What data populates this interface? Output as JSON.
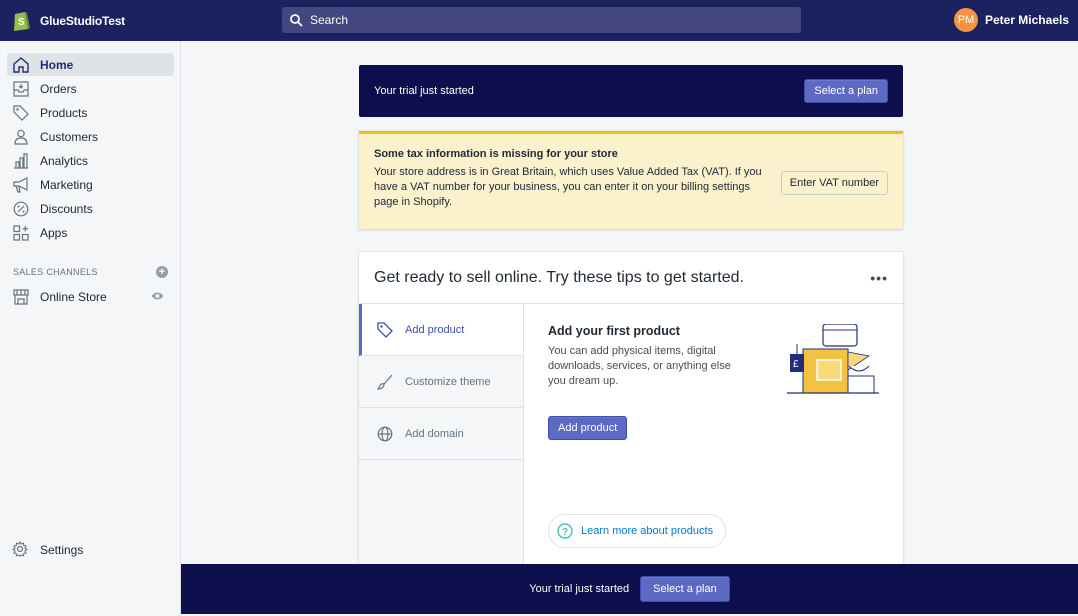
{
  "topbar": {
    "store_name": "GlueStudioTest",
    "search_placeholder": "Search",
    "user_initials": "PM",
    "user_name": "Peter Michaels"
  },
  "sidebar": {
    "items": [
      {
        "label": "Home",
        "icon": "home-icon",
        "active": true
      },
      {
        "label": "Orders",
        "icon": "orders-icon"
      },
      {
        "label": "Products",
        "icon": "tag-icon"
      },
      {
        "label": "Customers",
        "icon": "person-icon"
      },
      {
        "label": "Analytics",
        "icon": "bar-chart-icon"
      },
      {
        "label": "Marketing",
        "icon": "megaphone-icon"
      },
      {
        "label": "Discounts",
        "icon": "discount-icon"
      },
      {
        "label": "Apps",
        "icon": "apps-icon"
      }
    ],
    "channels_heading": "SALES CHANNELS",
    "online_store": "Online Store",
    "settings": "Settings"
  },
  "trial_banner": {
    "text": "Your trial just started",
    "button": "Select a plan"
  },
  "tax_warning": {
    "title": "Some tax information is missing for your store",
    "body": "Your store address is in Great Britain, which uses Value Added Tax (VAT). If you have a VAT number for your business, you can enter it on your billing settings page in Shopify.",
    "button": "Enter VAT number"
  },
  "tips_card": {
    "title": "Get ready to sell online. Try these tips to get started.",
    "more": "•••",
    "tabs": [
      {
        "label": "Add product",
        "icon": "tag-icon"
      },
      {
        "label": "Customize theme",
        "icon": "brush-icon"
      },
      {
        "label": "Add domain",
        "icon": "globe-icon"
      }
    ],
    "pane_title": "Add your first product",
    "pane_body": "You can add physical items, digital downloads, services, or anything else you dream up.",
    "pane_button": "Add product",
    "learn_more": "Learn more about products"
  },
  "bottom_bar": {
    "text": "Your trial just started",
    "button": "Select a plan"
  },
  "colors": {
    "topbar": "#1c2260",
    "banner": "#0c0f4b",
    "primary": "#5c6ac4",
    "warning_bg": "#fcf1cd",
    "warning_border": "#eec200"
  }
}
